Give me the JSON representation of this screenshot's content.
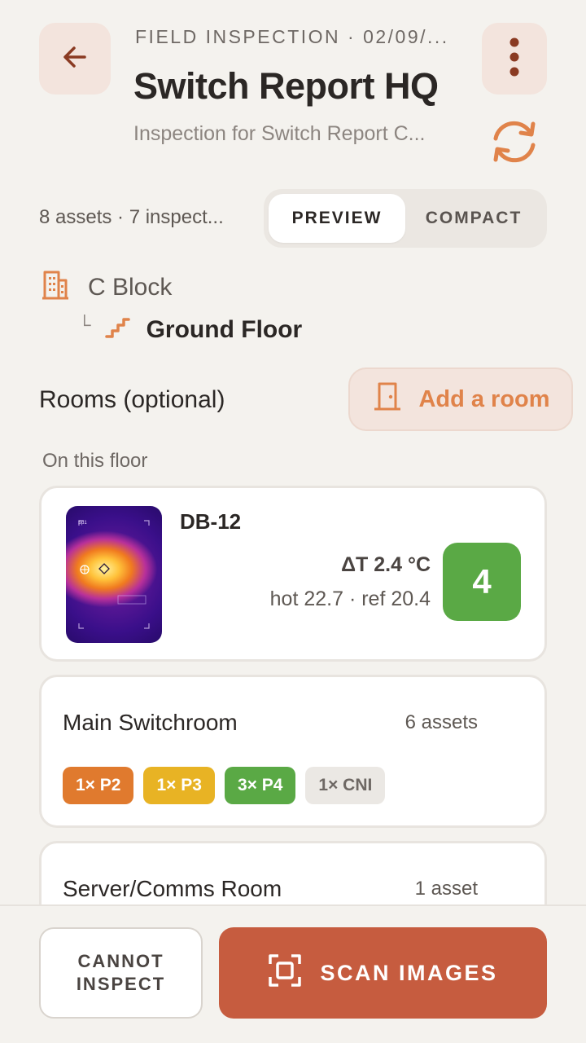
{
  "header": {
    "kicker": "FIELD INSPECTION · 02/09/...",
    "title": "Switch Report HQ",
    "subtitle": "Inspection for Switch Report C..."
  },
  "summary": "8 assets · 7 inspect...",
  "view_toggle": {
    "options": [
      "PREVIEW",
      "COMPACT"
    ],
    "selected": "PREVIEW"
  },
  "location": {
    "building": "C Block",
    "floor": "Ground Floor"
  },
  "rooms": {
    "title": "Rooms (optional)",
    "add_label": "Add a room",
    "section_label": "On this floor"
  },
  "asset_card": {
    "name": "DB-12",
    "delta": "ΔT 2.4 °C",
    "temps": "hot 22.7 · ref 20.4",
    "score": "4",
    "score_color": "#5aa945"
  },
  "room_cards": [
    {
      "name": "Main Switchroom",
      "count": "6 assets",
      "chips": [
        {
          "label": "1× P2",
          "bg": "#e07a2e",
          "fg": "#ffffff"
        },
        {
          "label": "1× P3",
          "bg": "#e8b324",
          "fg": "#ffffff"
        },
        {
          "label": "3× P4",
          "bg": "#5aa945",
          "fg": "#ffffff"
        },
        {
          "label": "1× CNI",
          "bg": "#ebe8e4",
          "fg": "#6e6864"
        }
      ]
    },
    {
      "name": "Server/Comms Room",
      "count": "1 asset"
    }
  ],
  "actions": {
    "cannot_inspect": "CANNOT INSPECT",
    "scan_images": "SCAN IMAGES"
  },
  "colors": {
    "accent": "#c65c3f",
    "accent_light": "#f3e4dd",
    "accent_text": "#e0834a"
  }
}
